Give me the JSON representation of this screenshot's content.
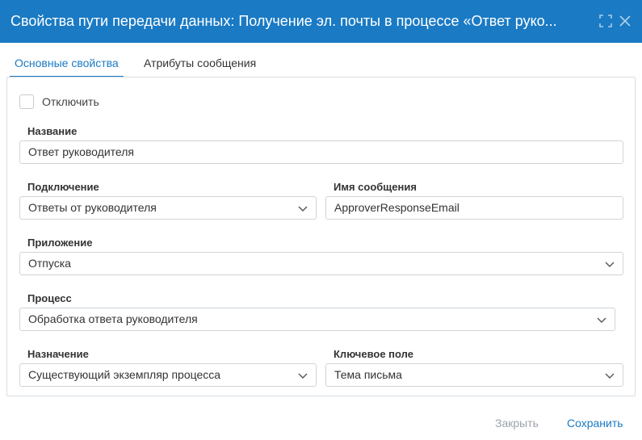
{
  "dialog": {
    "title": "Свойства пути передачи данных: Получение эл. почты в процессе «Ответ руко..."
  },
  "tabs": [
    {
      "label": "Основные свойства",
      "active": true
    },
    {
      "label": "Атрибуты сообщения",
      "active": false
    }
  ],
  "form": {
    "disable": {
      "label": "Отключить",
      "checked": false
    },
    "name": {
      "label": "Название",
      "value": "Ответ руководителя"
    },
    "connection": {
      "label": "Подключение",
      "value": "Ответы от руководителя"
    },
    "message_name": {
      "label": "Имя сообщения",
      "value": "ApproverResponseEmail"
    },
    "application": {
      "label": "Приложение",
      "value": "Отпуска"
    },
    "process": {
      "label": "Процесс",
      "value": "Обработка ответа руководителя"
    },
    "assignment": {
      "label": "Назначение",
      "value": "Существующий экземпляр процесса"
    },
    "key_field": {
      "label": "Ключевое поле",
      "value": "Тема письма"
    }
  },
  "footer": {
    "close_label": "Закрыть",
    "save_label": "Сохранить"
  },
  "colors": {
    "accent": "#1a7ac4",
    "disabled_text": "#9aa3ab",
    "border": "#cfd4d9"
  }
}
